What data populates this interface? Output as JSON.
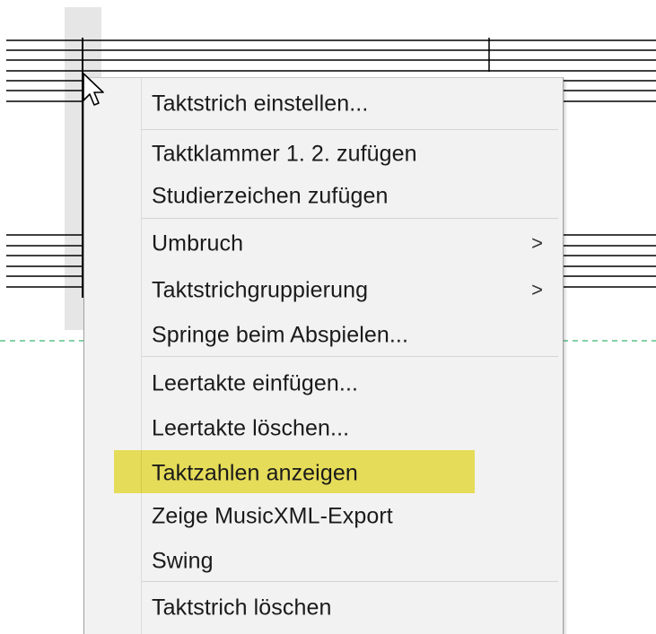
{
  "context_menu": {
    "items": [
      {
        "label": "Taktstrich einstellen..."
      },
      {
        "label": "Taktklammer 1. 2. zufügen"
      },
      {
        "label": "Studierzeichen zufügen"
      },
      {
        "label": "Umbruch",
        "submenu_arrow": ">"
      },
      {
        "label": "Taktstrichgruppierung",
        "submenu_arrow": ">"
      },
      {
        "label": "Springe beim Abspielen..."
      },
      {
        "label": "Leertakte einfügen..."
      },
      {
        "label": "Leertakte löschen..."
      },
      {
        "label": "Taktzahlen anzeigen"
      },
      {
        "label": "Zeige MusicXML-Export"
      },
      {
        "label": "Swing"
      },
      {
        "label": "Taktstrich löschen"
      }
    ]
  },
  "colors": {
    "highlight": "#f0e442",
    "menu_background": "#f2f2f2",
    "selection_bar": "#e6e6e6",
    "page_break_line": "#3cb371"
  }
}
